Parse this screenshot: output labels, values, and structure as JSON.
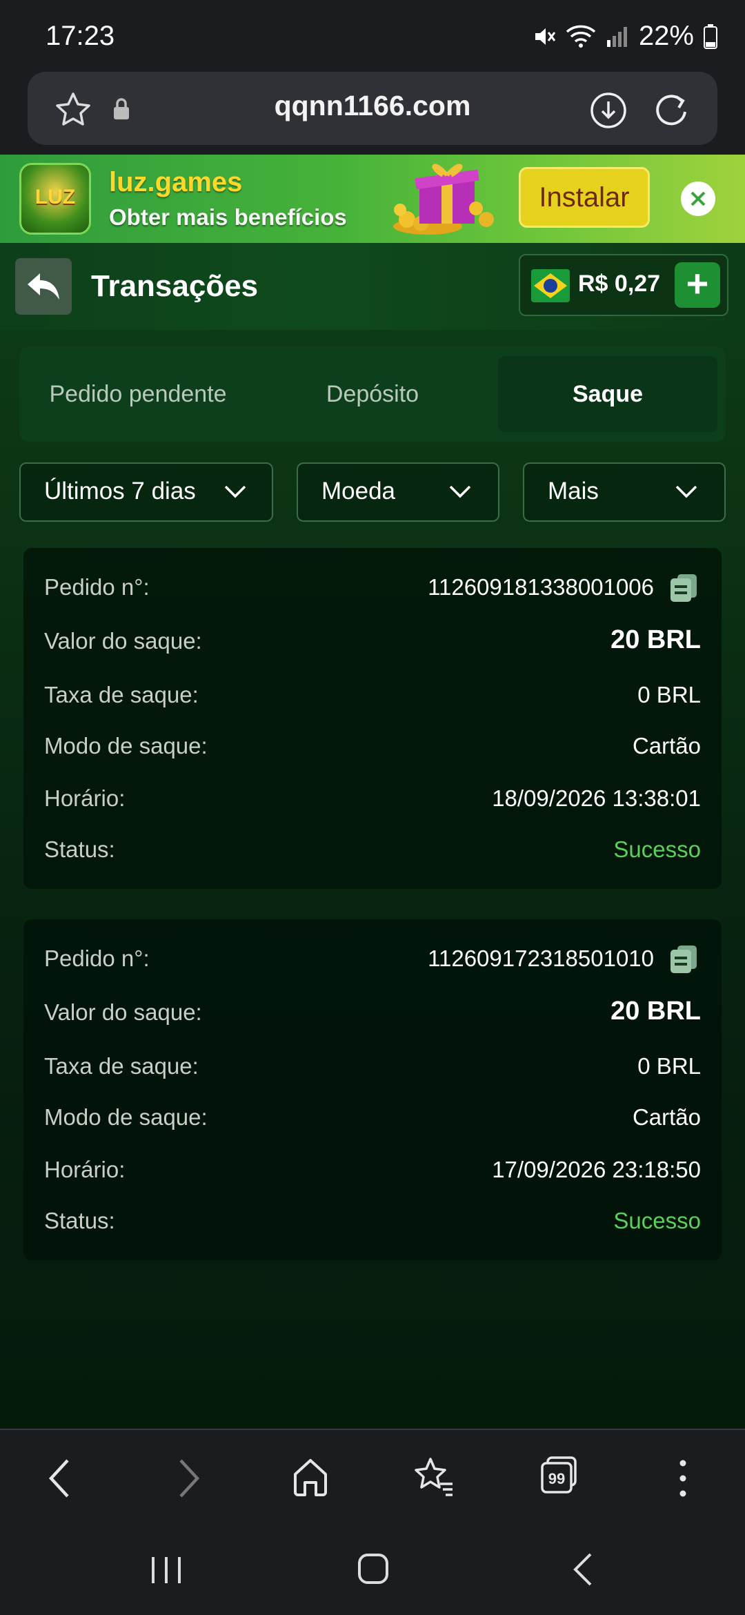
{
  "status_bar": {
    "time": "17:23",
    "battery": "22%"
  },
  "browser": {
    "url": "qqnn1166.com"
  },
  "banner": {
    "app_name": "luz.games",
    "subtitle": "Obter mais benefícios",
    "install_label": "Instalar",
    "icon_text": "LUZ"
  },
  "header": {
    "title": "Transações",
    "balance": "R$ 0,27"
  },
  "tabs": [
    {
      "label": "Pedido pendente",
      "active": false
    },
    {
      "label": "Depósito",
      "active": false
    },
    {
      "label": "Saque",
      "active": true
    }
  ],
  "filters": {
    "period": "Últimos 7 dias",
    "currency": "Moeda",
    "more": "Mais"
  },
  "labels": {
    "order": "Pedido n°:",
    "amount": "Valor do saque:",
    "fee": "Taxa de saque:",
    "mode": "Modo de saque:",
    "time": "Horário:",
    "status": "Status:"
  },
  "transactions": [
    {
      "order": "112609181338001006",
      "amount": "20 BRL",
      "fee": "0 BRL",
      "mode": "Cartão",
      "time": "18/09/2026 13:38:01",
      "status": "Sucesso"
    },
    {
      "order": "112609172318501010",
      "amount": "20 BRL",
      "fee": "0 BRL",
      "mode": "Cartão",
      "time": "17/09/2026 23:18:50",
      "status": "Sucesso"
    }
  ],
  "nav": {
    "tabs_count": "99"
  },
  "colors": {
    "success": "#59d15a",
    "accent": "#1f8f34",
    "install": "#e6d21c"
  }
}
